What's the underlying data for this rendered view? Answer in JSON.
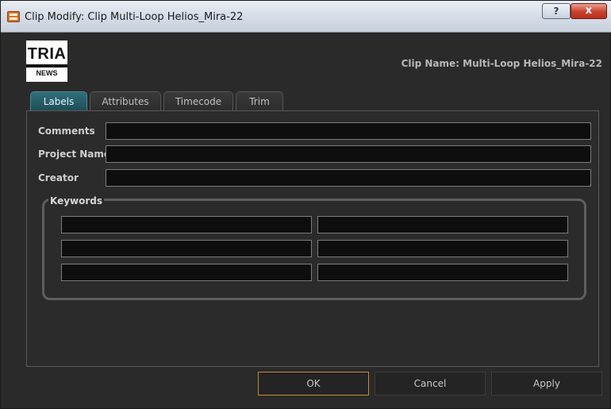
{
  "window": {
    "title": "Clip Modify: Clip Multi-Loop Helios_Mira-22",
    "help_label": "?",
    "close_label": "x"
  },
  "logo": {
    "main": "TRIA",
    "sub": "NEWS"
  },
  "clip_name": "Clip Name: Multi-Loop Helios_Mira-22",
  "tabs": [
    {
      "label": "Labels",
      "active": true
    },
    {
      "label": "Attributes",
      "active": false
    },
    {
      "label": "Timecode",
      "active": false
    },
    {
      "label": "Trim",
      "active": false
    }
  ],
  "fields": {
    "comments": {
      "label": "Comments",
      "value": ""
    },
    "project_name": {
      "label": "Project Name",
      "value": ""
    },
    "creator": {
      "label": "Creator",
      "value": ""
    }
  },
  "keywords": {
    "title": "Keywords",
    "values": [
      "",
      "",
      "",
      "",
      "",
      ""
    ]
  },
  "buttons": {
    "ok": "OK",
    "cancel": "Cancel",
    "apply": "Apply"
  },
  "colors": {
    "active_tab": "#2f6f7b",
    "default_button_border": "#c28a36",
    "input_bg": "#0e0e0e"
  }
}
